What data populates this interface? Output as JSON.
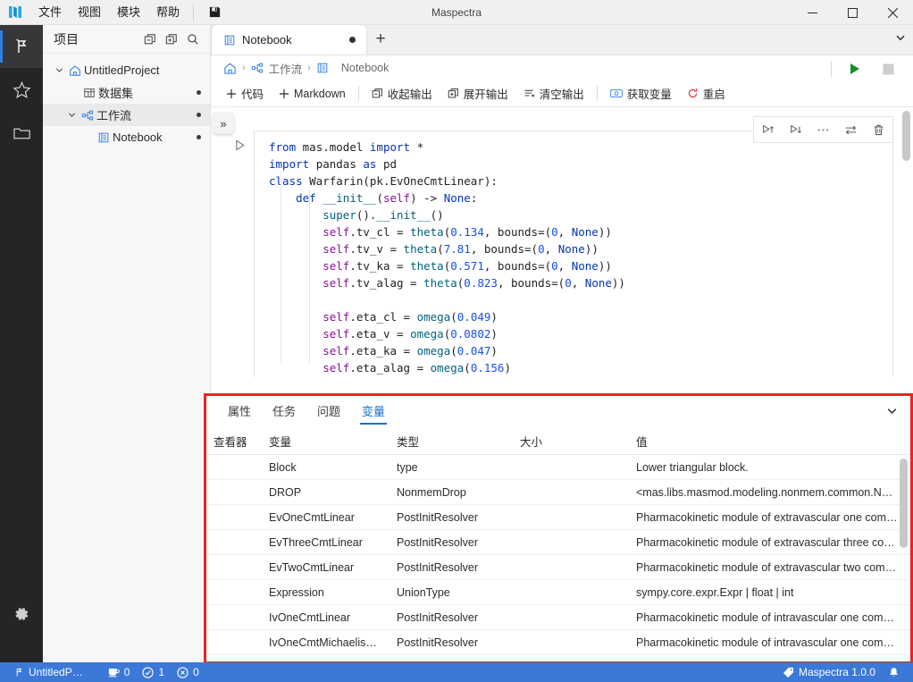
{
  "titlebar": {
    "app_title": "Maspectra",
    "menus": [
      "文件",
      "视图",
      "模块",
      "帮助"
    ],
    "save_icon": "save-icon",
    "minimize": "−",
    "maximize": "▢",
    "close": "✕"
  },
  "activity_bar": {
    "items": [
      {
        "name": "workflow-icon",
        "active": true
      },
      {
        "name": "star-icon",
        "active": false
      },
      {
        "name": "folder-icon",
        "active": false
      }
    ],
    "settings": {
      "name": "gear-icon"
    }
  },
  "sidebar": {
    "title": "项目",
    "header_icons": [
      "collapse-all-icon",
      "expand-all-icon",
      "search-icon"
    ],
    "tree": [
      {
        "label": "UntitledProject",
        "icon": "home-icon",
        "depth": 0,
        "expanded": true,
        "dot": false,
        "selected": false
      },
      {
        "label": "数据集",
        "icon": "dataset-icon",
        "depth": 1,
        "expanded": null,
        "dot": true,
        "selected": false
      },
      {
        "label": "工作流",
        "icon": "workflow-node-icon",
        "depth": 1,
        "expanded": true,
        "dot": true,
        "selected": true
      },
      {
        "label": "Notebook",
        "icon": "notebook-icon",
        "depth": 2,
        "expanded": null,
        "dot": true,
        "selected": false
      }
    ]
  },
  "editor": {
    "tab": {
      "label": "Notebook",
      "icon": "notebook-icon",
      "dirty": true
    },
    "add_tab": "+",
    "tabbar_chevron": "chevron-down-icon",
    "breadcrumb": [
      {
        "label": "",
        "icon": "home-icon"
      },
      {
        "label": "工作流",
        "icon": "workflow-node-icon"
      },
      {
        "label": "Notebook",
        "icon": "notebook-icon"
      }
    ],
    "run_button": "run-icon",
    "stop_button": "stop-icon",
    "toolbar": [
      {
        "label": "代码",
        "icon": "plus-icon"
      },
      {
        "label": "Markdown",
        "icon": "plus-icon"
      },
      {
        "label": "收起输出",
        "icon": "collapse-output-icon"
      },
      {
        "label": "展开输出",
        "icon": "expand-output-icon"
      },
      {
        "label": "清空输出",
        "icon": "clear-output-icon"
      },
      {
        "label": "获取变量",
        "icon": "get-variables-icon"
      },
      {
        "label": "重启",
        "icon": "restart-icon"
      }
    ],
    "collapse_button": "»",
    "cell_toolbar": [
      "run-above-icon",
      "run-below-icon",
      "more-icon",
      "move-icon",
      "delete-icon"
    ],
    "cell_run_icon": "run-cell-icon"
  },
  "code_lines": [
    [
      {
        "t": "from ",
        "c": "k"
      },
      {
        "t": "mas.model ",
        "c": "ident"
      },
      {
        "t": "import",
        "c": "k"
      },
      {
        "t": " *",
        "c": "op"
      }
    ],
    [
      {
        "t": "import ",
        "c": "k"
      },
      {
        "t": "pandas ",
        "c": "ident"
      },
      {
        "t": "as ",
        "c": "k"
      },
      {
        "t": "pd",
        "c": "ident"
      }
    ],
    [
      {
        "t": "class ",
        "c": "k"
      },
      {
        "t": "Warfarin",
        "c": "ident"
      },
      {
        "t": "(pk.EvOneCmtLinear):",
        "c": "op"
      }
    ],
    [
      {
        "t": "    def ",
        "c": "k"
      },
      {
        "t": "__init__",
        "c": "fn"
      },
      {
        "t": "(",
        "c": "op"
      },
      {
        "t": "self",
        "c": "self"
      },
      {
        "t": ") -> ",
        "c": "op"
      },
      {
        "t": "None",
        "c": "k"
      },
      {
        "t": ":",
        "c": "op"
      }
    ],
    [
      {
        "t": "        super",
        "c": "fn"
      },
      {
        "t": "().",
        "c": "op"
      },
      {
        "t": "__init__",
        "c": "fn"
      },
      {
        "t": "()",
        "c": "op"
      }
    ],
    [
      {
        "t": "        ",
        "c": "op"
      },
      {
        "t": "self",
        "c": "self"
      },
      {
        "t": ".tv_cl = ",
        "c": "op"
      },
      {
        "t": "theta",
        "c": "fn"
      },
      {
        "t": "(",
        "c": "op"
      },
      {
        "t": "0.134",
        "c": "num"
      },
      {
        "t": ", bounds=(",
        "c": "op"
      },
      {
        "t": "0",
        "c": "num"
      },
      {
        "t": ", ",
        "c": "op"
      },
      {
        "t": "None",
        "c": "k"
      },
      {
        "t": "))",
        "c": "op"
      }
    ],
    [
      {
        "t": "        ",
        "c": "op"
      },
      {
        "t": "self",
        "c": "self"
      },
      {
        "t": ".tv_v = ",
        "c": "op"
      },
      {
        "t": "theta",
        "c": "fn"
      },
      {
        "t": "(",
        "c": "op"
      },
      {
        "t": "7.81",
        "c": "num"
      },
      {
        "t": ", bounds=(",
        "c": "op"
      },
      {
        "t": "0",
        "c": "num"
      },
      {
        "t": ", ",
        "c": "op"
      },
      {
        "t": "None",
        "c": "k"
      },
      {
        "t": "))",
        "c": "op"
      }
    ],
    [
      {
        "t": "        ",
        "c": "op"
      },
      {
        "t": "self",
        "c": "self"
      },
      {
        "t": ".tv_ka = ",
        "c": "op"
      },
      {
        "t": "theta",
        "c": "fn"
      },
      {
        "t": "(",
        "c": "op"
      },
      {
        "t": "0.571",
        "c": "num"
      },
      {
        "t": ", bounds=(",
        "c": "op"
      },
      {
        "t": "0",
        "c": "num"
      },
      {
        "t": ", ",
        "c": "op"
      },
      {
        "t": "None",
        "c": "k"
      },
      {
        "t": "))",
        "c": "op"
      }
    ],
    [
      {
        "t": "        ",
        "c": "op"
      },
      {
        "t": "self",
        "c": "self"
      },
      {
        "t": ".tv_alag = ",
        "c": "op"
      },
      {
        "t": "theta",
        "c": "fn"
      },
      {
        "t": "(",
        "c": "op"
      },
      {
        "t": "0.823",
        "c": "num"
      },
      {
        "t": ", bounds=(",
        "c": "op"
      },
      {
        "t": "0",
        "c": "num"
      },
      {
        "t": ", ",
        "c": "op"
      },
      {
        "t": "None",
        "c": "k"
      },
      {
        "t": "))",
        "c": "op"
      }
    ],
    [],
    [
      {
        "t": "        ",
        "c": "op"
      },
      {
        "t": "self",
        "c": "self"
      },
      {
        "t": ".eta_cl = ",
        "c": "op"
      },
      {
        "t": "omega",
        "c": "fn"
      },
      {
        "t": "(",
        "c": "op"
      },
      {
        "t": "0.049",
        "c": "num"
      },
      {
        "t": ")",
        "c": "op"
      }
    ],
    [
      {
        "t": "        ",
        "c": "op"
      },
      {
        "t": "self",
        "c": "self"
      },
      {
        "t": ".eta_v = ",
        "c": "op"
      },
      {
        "t": "omega",
        "c": "fn"
      },
      {
        "t": "(",
        "c": "op"
      },
      {
        "t": "0.0802",
        "c": "num"
      },
      {
        "t": ")",
        "c": "op"
      }
    ],
    [
      {
        "t": "        ",
        "c": "op"
      },
      {
        "t": "self",
        "c": "self"
      },
      {
        "t": ".eta_ka = ",
        "c": "op"
      },
      {
        "t": "omega",
        "c": "fn"
      },
      {
        "t": "(",
        "c": "op"
      },
      {
        "t": "0.047",
        "c": "num"
      },
      {
        "t": ")",
        "c": "op"
      }
    ],
    [
      {
        "t": "        ",
        "c": "op"
      },
      {
        "t": "self",
        "c": "self"
      },
      {
        "t": ".eta_alag = ",
        "c": "op"
      },
      {
        "t": "omega",
        "c": "fn"
      },
      {
        "t": "(",
        "c": "op"
      },
      {
        "t": "0.156",
        "c": "num"
      },
      {
        "t": ")",
        "c": "op"
      }
    ]
  ],
  "variables_panel": {
    "tabs": [
      {
        "label": "属性",
        "active": false
      },
      {
        "label": "任务",
        "active": false
      },
      {
        "label": "问题",
        "active": false
      },
      {
        "label": "变量",
        "active": true
      }
    ],
    "chevron": "chevron-down-icon",
    "columns": [
      "查看器",
      "变量",
      "类型",
      "大小",
      "值"
    ],
    "rows": [
      {
        "viewer": "",
        "variable": "Block",
        "type": "type",
        "size": "",
        "value": "Lower triangular block."
      },
      {
        "viewer": "",
        "variable": "DROP",
        "type": "NonmemDrop",
        "size": "",
        "value": "<mas.libs.masmod.modeling.nonmem.common.No…"
      },
      {
        "viewer": "",
        "variable": "EvOneCmtLinear",
        "type": "PostInitResolver",
        "size": "",
        "value": "Pharmacokinetic module of extravascular one com…"
      },
      {
        "viewer": "",
        "variable": "EvThreeCmtLinear",
        "type": "PostInitResolver",
        "size": "",
        "value": "Pharmacokinetic module of extravascular three co…"
      },
      {
        "viewer": "",
        "variable": "EvTwoCmtLinear",
        "type": "PostInitResolver",
        "size": "",
        "value": "Pharmacokinetic module of extravascular two comp…"
      },
      {
        "viewer": "",
        "variable": "Expression",
        "type": "UnionType",
        "size": "",
        "value": "sympy.core.expr.Expr | float | int"
      },
      {
        "viewer": "",
        "variable": "IvOneCmtLinear",
        "type": "PostInitResolver",
        "size": "",
        "value": "Pharmacokinetic module of intravascular one comp…"
      },
      {
        "viewer": "",
        "variable": "IvOneCmtMichaelis…",
        "type": "PostInitResolver",
        "size": "",
        "value": "Pharmacokinetic module of intravascular one comp…"
      }
    ]
  },
  "statusbar": {
    "project_icon": "workflow-icon",
    "project": "UntitledP…",
    "kernel_icon": "kernel-icon",
    "kernel_count": "0",
    "ok_icon": "check-icon",
    "ok_count": "1",
    "error_icon": "error-icon",
    "error_count": "0",
    "version_icon": "tag-icon",
    "version": "Maspectra 1.0.0",
    "bell_icon": "bell-icon"
  },
  "colors": {
    "accent": "#3b78d8",
    "highlight_border": "#ee2222",
    "tab_active": "#1a73c8",
    "run_green": "#1a8c28"
  }
}
